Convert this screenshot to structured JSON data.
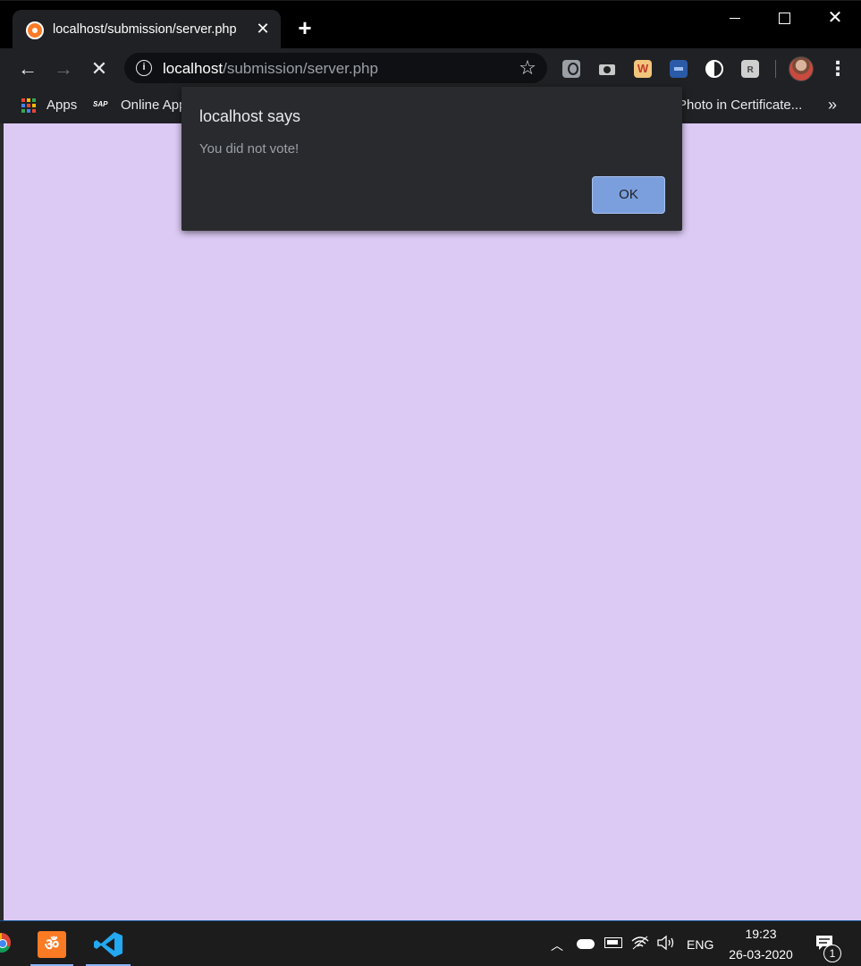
{
  "tab": {
    "title": "localhost/submission/server.php",
    "close": "✕"
  },
  "new_tab": "+",
  "window": {
    "minimize": "",
    "maximize": "",
    "close": "✕"
  },
  "omnibox": {
    "host": "localhost",
    "path": "/submission/server.php"
  },
  "bookmarks": {
    "apps": "Apps",
    "online_app": "Online App",
    "photo_cert": "Photo in Certificate...",
    "more": "»"
  },
  "page": {
    "background": "#dccaf4"
  },
  "dialog": {
    "title": "localhost says",
    "message": "You did not vote!",
    "ok": "OK"
  },
  "taskbar": {
    "lang": "ENG",
    "time": "19:23",
    "date": "26-03-2020",
    "notifications": "1"
  },
  "icons": [
    "tab-favicon",
    "back-icon",
    "forward-icon",
    "stop-icon",
    "info-icon",
    "star-icon",
    "bulb-extension-icon",
    "camera-extension-icon",
    "w-extension-icon",
    "blue-extension-icon",
    "contrast-extension-icon",
    "k-extension-icon",
    "avatar",
    "menu-icon",
    "apps-grid-icon",
    "sap-icon",
    "chrome-icon",
    "xampp-icon",
    "vscode-icon",
    "wifi-icon",
    "volume-icon",
    "notification-icon"
  ]
}
